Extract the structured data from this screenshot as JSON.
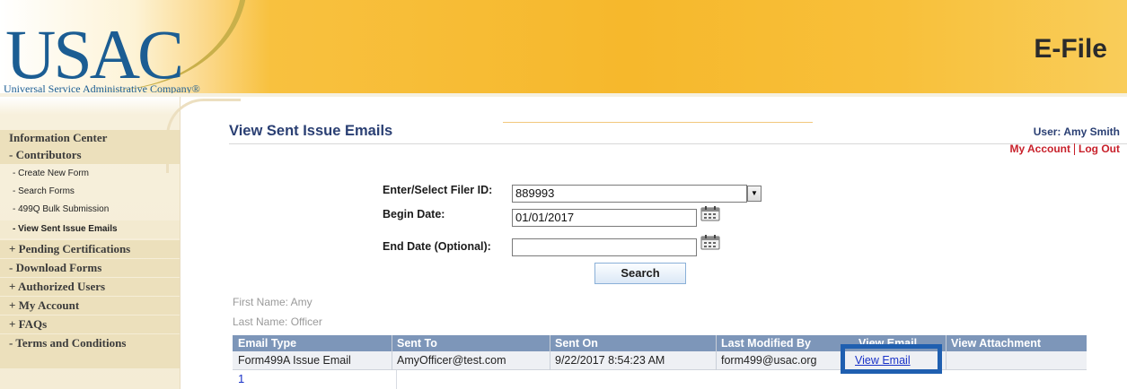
{
  "header": {
    "logo_text": "USAC",
    "logo_subtitle": "Universal Service Administrative Company®",
    "app_title": "E-File"
  },
  "sidebar": {
    "header": "Information Center",
    "items": [
      {
        "label": "- Contributors"
      },
      {
        "label": "- Create New Form"
      },
      {
        "label": "- Search Forms"
      },
      {
        "label": "- 499Q Bulk Submission"
      },
      {
        "label": "- View Sent Issue Emails"
      },
      {
        "label": "+ Pending Certifications"
      },
      {
        "label": "- Download Forms"
      },
      {
        "label": "+ Authorized Users"
      },
      {
        "label": "+ My Account"
      },
      {
        "label": "+ FAQs"
      },
      {
        "label": "- Terms and Conditions"
      }
    ]
  },
  "page": {
    "title": "View Sent Issue Emails",
    "user_label": "User: Amy Smith",
    "my_account": "My Account",
    "log_out": "Log Out"
  },
  "form": {
    "filer_label": "Enter/Select Filer ID:",
    "filer_value": "889993",
    "begin_label": "Begin Date:",
    "begin_value": "01/01/2017",
    "end_label": "End Date (Optional):",
    "end_value": "",
    "search_label": "Search",
    "dropdown_icon": "chevron-down-icon",
    "calendar_icon": "calendar-icon"
  },
  "contact": {
    "first_name": "First Name: Amy",
    "last_name": "Last Name: Officer"
  },
  "table": {
    "headers": [
      "Email Type",
      "Sent To",
      "Sent On",
      "Last Modified By",
      "View Email",
      "View Attachment"
    ],
    "rows": [
      {
        "email_type": "Form499A Issue Email",
        "sent_to": "AmyOfficer@test.com",
        "sent_on": "9/22/2017 8:54:23 AM",
        "modified_by": "form499@usac.org",
        "view_email": "View Email",
        "view_attachment": ""
      }
    ],
    "pager": "1"
  },
  "colors": {
    "header_gold": "#f6b82c",
    "title_navy": "#2a3f73",
    "table_header": "#7d96b9",
    "link_red": "#c8212b",
    "highlight_blue": "#1f5fb0"
  }
}
